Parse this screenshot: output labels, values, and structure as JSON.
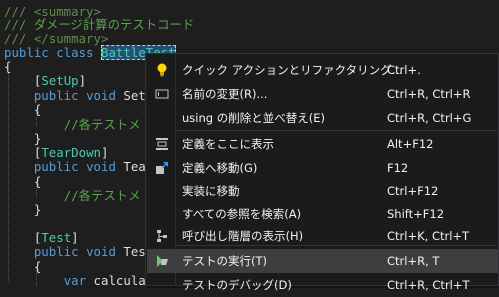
{
  "code": {
    "lines": [
      {
        "segments": [
          {
            "t": "/// <summary>",
            "c": "xml"
          }
        ]
      },
      {
        "segments": [
          {
            "t": "/// ",
            "c": "xml"
          },
          {
            "t": "ダメージ計算のテストコード",
            "c": "comment"
          }
        ]
      },
      {
        "segments": [
          {
            "t": "/// </summary>",
            "c": "xml"
          }
        ]
      },
      {
        "segments": [
          {
            "t": "public ",
            "c": "kw"
          },
          {
            "t": "class ",
            "c": "kw"
          },
          {
            "t": "BattleTest",
            "c": "type",
            "hl": true
          }
        ]
      },
      {
        "segments": [
          {
            "t": "{",
            "c": "plain"
          }
        ]
      },
      {
        "segments": [
          {
            "t": "    [",
            "c": "plain"
          },
          {
            "t": "SetUp",
            "c": "type"
          },
          {
            "t": "]",
            "c": "plain"
          }
        ]
      },
      {
        "segments": [
          {
            "t": "    ",
            "c": "plain"
          },
          {
            "t": "public ",
            "c": "kw"
          },
          {
            "t": "void ",
            "c": "kw"
          },
          {
            "t": "Setu",
            "c": "plain"
          }
        ]
      },
      {
        "segments": [
          {
            "t": "    {",
            "c": "plain"
          }
        ]
      },
      {
        "segments": [
          {
            "t": "        ",
            "c": "plain"
          },
          {
            "t": "//各テストメ",
            "c": "comment"
          }
        ]
      },
      {
        "segments": [
          {
            "t": "    }",
            "c": "plain"
          }
        ]
      },
      {
        "segments": [
          {
            "t": "    [",
            "c": "plain"
          },
          {
            "t": "TearDown",
            "c": "type"
          },
          {
            "t": "]",
            "c": "plain"
          }
        ]
      },
      {
        "segments": [
          {
            "t": "    ",
            "c": "plain"
          },
          {
            "t": "public ",
            "c": "kw"
          },
          {
            "t": "void ",
            "c": "kw"
          },
          {
            "t": "Tear",
            "c": "plain"
          }
        ]
      },
      {
        "segments": [
          {
            "t": "    {",
            "c": "plain"
          }
        ]
      },
      {
        "segments": [
          {
            "t": "        ",
            "c": "plain"
          },
          {
            "t": "//各テストメ",
            "c": "comment"
          }
        ]
      },
      {
        "segments": [
          {
            "t": "    }",
            "c": "plain"
          }
        ]
      },
      {
        "segments": []
      },
      {
        "segments": [
          {
            "t": "    [",
            "c": "plain"
          },
          {
            "t": "Test",
            "c": "type"
          },
          {
            "t": "]",
            "c": "plain"
          }
        ]
      },
      {
        "segments": [
          {
            "t": "    ",
            "c": "plain"
          },
          {
            "t": "public ",
            "c": "kw"
          },
          {
            "t": "void ",
            "c": "kw"
          },
          {
            "t": "Test",
            "c": "plain"
          }
        ]
      },
      {
        "segments": [
          {
            "t": "    {",
            "c": "plain"
          }
        ]
      },
      {
        "segments": [
          {
            "t": "        ",
            "c": "plain"
          },
          {
            "t": "var ",
            "c": "kw"
          },
          {
            "t": "calculat",
            "c": "plain"
          }
        ]
      }
    ]
  },
  "context_menu": {
    "items": [
      {
        "icon": "lightbulb-icon",
        "label": "クイック アクションとリファクタリング...",
        "shortcut": "Ctrl+.",
        "name": "menu-item-quick-actions"
      },
      {
        "icon": "rename-icon",
        "label": "名前の変更(R)...",
        "shortcut": "Ctrl+R, Ctrl+R",
        "name": "menu-item-rename"
      },
      {
        "icon": "",
        "label": "using の削除と並べ替え(E)",
        "shortcut": "Ctrl+R, Ctrl+G",
        "name": "menu-item-remove-sort-usings"
      },
      {
        "icon": "peek-definition-icon",
        "label": "定義をここに表示",
        "shortcut": "Alt+F12",
        "name": "menu-item-peek-definition"
      },
      {
        "icon": "go-to-definition-icon",
        "label": "定義へ移動(G)",
        "shortcut": "F12",
        "name": "menu-item-go-to-definition"
      },
      {
        "icon": "",
        "label": "実装に移動",
        "shortcut": "Ctrl+F12",
        "name": "menu-item-go-to-implementation"
      },
      {
        "icon": "",
        "label": "すべての参照を検索(A)",
        "shortcut": "Shift+F12",
        "name": "menu-item-find-all-references"
      },
      {
        "icon": "call-hierarchy-icon",
        "label": "呼び出し階層の表示(H)",
        "shortcut": "Ctrl+K, Ctrl+T",
        "name": "menu-item-call-hierarchy"
      },
      {
        "icon": "run-tests-icon",
        "label": "テストの実行(T)",
        "shortcut": "Ctrl+R, T",
        "name": "menu-item-run-tests",
        "active": true
      },
      {
        "icon": "",
        "label": "テストのデバッグ(D)",
        "shortcut": "Ctrl+R, Ctrl+T",
        "name": "menu-item-debug-tests"
      }
    ]
  },
  "colors": {
    "editor_bg": "#1e1e1e",
    "menu_bg": "#1b1b1c",
    "menu_highlight": "#3e3e40",
    "keyword": "#569cd6",
    "type": "#4ec9b0",
    "comment": "#57a64a"
  }
}
